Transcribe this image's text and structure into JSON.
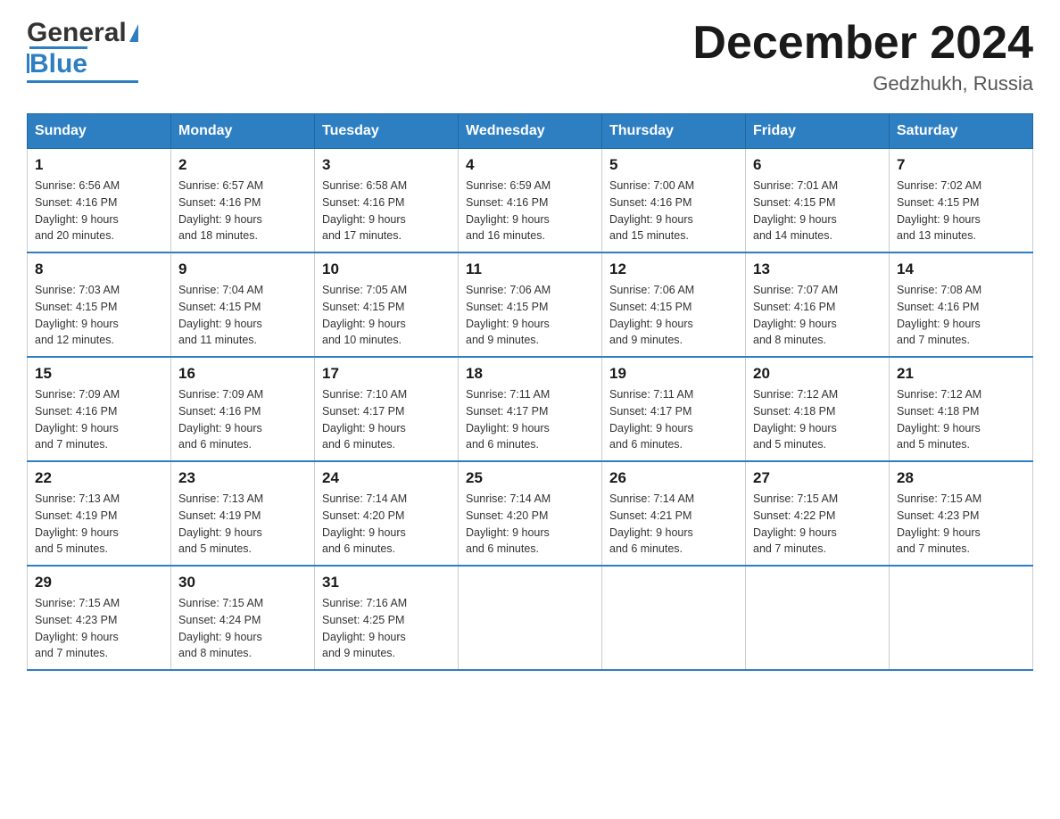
{
  "header": {
    "logo_general": "General",
    "logo_blue": "Blue",
    "month_title": "December 2024",
    "location": "Gedzhukh, Russia"
  },
  "weekdays": [
    "Sunday",
    "Monday",
    "Tuesday",
    "Wednesday",
    "Thursday",
    "Friday",
    "Saturday"
  ],
  "weeks": [
    [
      {
        "day": "1",
        "sunrise": "6:56 AM",
        "sunset": "4:16 PM",
        "daylight": "9 hours and 20 minutes."
      },
      {
        "day": "2",
        "sunrise": "6:57 AM",
        "sunset": "4:16 PM",
        "daylight": "9 hours and 18 minutes."
      },
      {
        "day": "3",
        "sunrise": "6:58 AM",
        "sunset": "4:16 PM",
        "daylight": "9 hours and 17 minutes."
      },
      {
        "day": "4",
        "sunrise": "6:59 AM",
        "sunset": "4:16 PM",
        "daylight": "9 hours and 16 minutes."
      },
      {
        "day": "5",
        "sunrise": "7:00 AM",
        "sunset": "4:16 PM",
        "daylight": "9 hours and 15 minutes."
      },
      {
        "day": "6",
        "sunrise": "7:01 AM",
        "sunset": "4:15 PM",
        "daylight": "9 hours and 14 minutes."
      },
      {
        "day": "7",
        "sunrise": "7:02 AM",
        "sunset": "4:15 PM",
        "daylight": "9 hours and 13 minutes."
      }
    ],
    [
      {
        "day": "8",
        "sunrise": "7:03 AM",
        "sunset": "4:15 PM",
        "daylight": "9 hours and 12 minutes."
      },
      {
        "day": "9",
        "sunrise": "7:04 AM",
        "sunset": "4:15 PM",
        "daylight": "9 hours and 11 minutes."
      },
      {
        "day": "10",
        "sunrise": "7:05 AM",
        "sunset": "4:15 PM",
        "daylight": "9 hours and 10 minutes."
      },
      {
        "day": "11",
        "sunrise": "7:06 AM",
        "sunset": "4:15 PM",
        "daylight": "9 hours and 9 minutes."
      },
      {
        "day": "12",
        "sunrise": "7:06 AM",
        "sunset": "4:15 PM",
        "daylight": "9 hours and 9 minutes."
      },
      {
        "day": "13",
        "sunrise": "7:07 AM",
        "sunset": "4:16 PM",
        "daylight": "9 hours and 8 minutes."
      },
      {
        "day": "14",
        "sunrise": "7:08 AM",
        "sunset": "4:16 PM",
        "daylight": "9 hours and 7 minutes."
      }
    ],
    [
      {
        "day": "15",
        "sunrise": "7:09 AM",
        "sunset": "4:16 PM",
        "daylight": "9 hours and 7 minutes."
      },
      {
        "day": "16",
        "sunrise": "7:09 AM",
        "sunset": "4:16 PM",
        "daylight": "9 hours and 6 minutes."
      },
      {
        "day": "17",
        "sunrise": "7:10 AM",
        "sunset": "4:17 PM",
        "daylight": "9 hours and 6 minutes."
      },
      {
        "day": "18",
        "sunrise": "7:11 AM",
        "sunset": "4:17 PM",
        "daylight": "9 hours and 6 minutes."
      },
      {
        "day": "19",
        "sunrise": "7:11 AM",
        "sunset": "4:17 PM",
        "daylight": "9 hours and 6 minutes."
      },
      {
        "day": "20",
        "sunrise": "7:12 AM",
        "sunset": "4:18 PM",
        "daylight": "9 hours and 5 minutes."
      },
      {
        "day": "21",
        "sunrise": "7:12 AM",
        "sunset": "4:18 PM",
        "daylight": "9 hours and 5 minutes."
      }
    ],
    [
      {
        "day": "22",
        "sunrise": "7:13 AM",
        "sunset": "4:19 PM",
        "daylight": "9 hours and 5 minutes."
      },
      {
        "day": "23",
        "sunrise": "7:13 AM",
        "sunset": "4:19 PM",
        "daylight": "9 hours and 5 minutes."
      },
      {
        "day": "24",
        "sunrise": "7:14 AM",
        "sunset": "4:20 PM",
        "daylight": "9 hours and 6 minutes."
      },
      {
        "day": "25",
        "sunrise": "7:14 AM",
        "sunset": "4:20 PM",
        "daylight": "9 hours and 6 minutes."
      },
      {
        "day": "26",
        "sunrise": "7:14 AM",
        "sunset": "4:21 PM",
        "daylight": "9 hours and 6 minutes."
      },
      {
        "day": "27",
        "sunrise": "7:15 AM",
        "sunset": "4:22 PM",
        "daylight": "9 hours and 7 minutes."
      },
      {
        "day": "28",
        "sunrise": "7:15 AM",
        "sunset": "4:23 PM",
        "daylight": "9 hours and 7 minutes."
      }
    ],
    [
      {
        "day": "29",
        "sunrise": "7:15 AM",
        "sunset": "4:23 PM",
        "daylight": "9 hours and 7 minutes."
      },
      {
        "day": "30",
        "sunrise": "7:15 AM",
        "sunset": "4:24 PM",
        "daylight": "9 hours and 8 minutes."
      },
      {
        "day": "31",
        "sunrise": "7:16 AM",
        "sunset": "4:25 PM",
        "daylight": "9 hours and 9 minutes."
      },
      null,
      null,
      null,
      null
    ]
  ]
}
